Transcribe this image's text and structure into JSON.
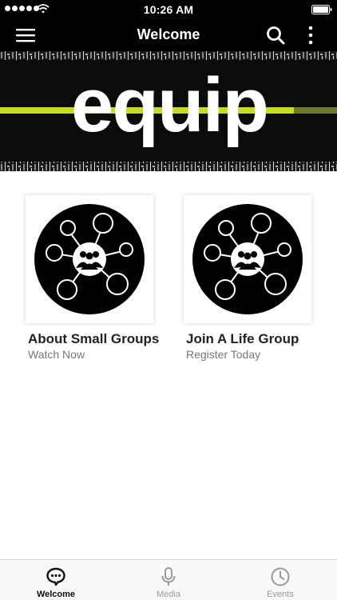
{
  "status_bar": {
    "time": "10:26 AM"
  },
  "nav": {
    "title": "Welcome"
  },
  "banner": {
    "text": "equip"
  },
  "cards": [
    {
      "title": "About Small Groups",
      "subtitle": "Watch Now",
      "icon": "small-groups-network-icon"
    },
    {
      "title": "Join A Life Group",
      "subtitle": "Register Today",
      "icon": "small-groups-network-icon"
    }
  ],
  "tabs": [
    {
      "label": "Welcome",
      "icon": "chat-bubble-icon",
      "active": true
    },
    {
      "label": "Media",
      "icon": "microphone-icon",
      "active": false
    },
    {
      "label": "Events",
      "icon": "clock-icon",
      "active": false
    }
  ],
  "colors": {
    "bar_background": "#000000",
    "banner_stripe": "#c6d92a",
    "active_tab": "#111111",
    "inactive_tab": "#9a9a9a"
  }
}
